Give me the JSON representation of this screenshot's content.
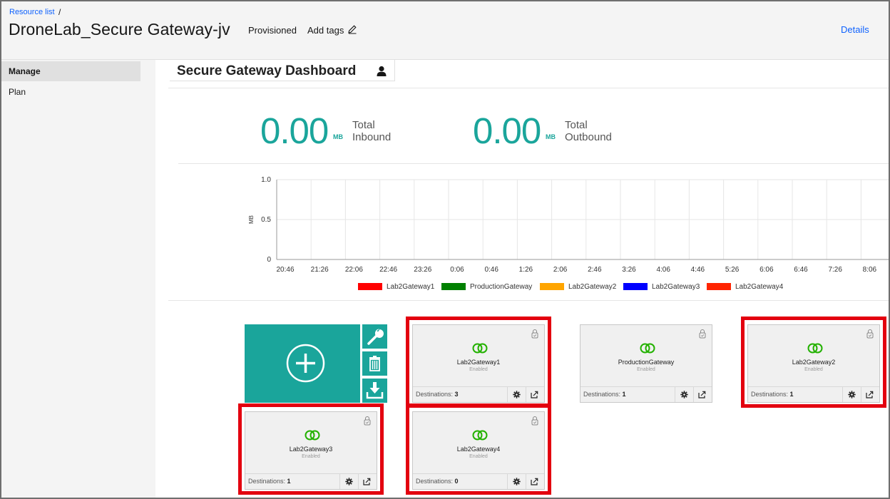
{
  "header": {
    "breadcrumb": "Resource list",
    "breadcrumb_sep": "/",
    "title": "DroneLab_Secure Gateway-jv",
    "status": "Provisioned",
    "add_tags": "Add tags",
    "details": "Details"
  },
  "sidebar": {
    "items": [
      {
        "label": "Manage",
        "active": true
      },
      {
        "label": "Plan",
        "active": false
      }
    ]
  },
  "dashboard": {
    "title": "Secure Gateway Dashboard",
    "inbound": {
      "value": "0.00",
      "unit": "MB",
      "label_line1": "Total",
      "label_line2": "Inbound"
    },
    "outbound": {
      "value": "0.00",
      "unit": "MB",
      "label_line1": "Total",
      "label_line2": "Outbound"
    }
  },
  "chart_data": {
    "type": "line",
    "ylabel": "MB",
    "ylim": [
      0,
      1.0
    ],
    "yticks": [
      "1.0",
      "0.5",
      "0"
    ],
    "categories": [
      "20:46",
      "21:26",
      "22:06",
      "22:46",
      "23:26",
      "0:06",
      "0:46",
      "1:26",
      "2:06",
      "2:46",
      "3:26",
      "4:06",
      "4:46",
      "5:26",
      "6:06",
      "6:46",
      "7:26",
      "8:06"
    ],
    "series": [
      {
        "name": "Lab2Gateway1",
        "color": "#ff0000",
        "values": [
          0,
          0,
          0,
          0,
          0,
          0,
          0,
          0,
          0,
          0,
          0,
          0,
          0,
          0,
          0,
          0,
          0,
          0
        ]
      },
      {
        "name": "ProductionGateway",
        "color": "#008000",
        "values": [
          0,
          0,
          0,
          0,
          0,
          0,
          0,
          0,
          0,
          0,
          0,
          0,
          0,
          0,
          0,
          0,
          0,
          0
        ]
      },
      {
        "name": "Lab2Gateway2",
        "color": "#ffa500",
        "values": [
          0,
          0,
          0,
          0,
          0,
          0,
          0,
          0,
          0,
          0,
          0,
          0,
          0,
          0,
          0,
          0,
          0,
          0
        ]
      },
      {
        "name": "Lab2Gateway3",
        "color": "#0000ff",
        "values": [
          0,
          0,
          0,
          0,
          0,
          0,
          0,
          0,
          0,
          0,
          0,
          0,
          0,
          0,
          0,
          0,
          0,
          0
        ]
      },
      {
        "name": "Lab2Gateway4",
        "color": "#ff2400",
        "values": [
          0,
          0,
          0,
          0,
          0,
          0,
          0,
          0,
          0,
          0,
          0,
          0,
          0,
          0,
          0,
          0,
          0,
          0
        ]
      }
    ],
    "grid": true,
    "legend": "bottom"
  },
  "gateways": [
    {
      "name": "Lab2Gateway1",
      "state": "Enabled",
      "dest_label": "Destinations:",
      "dest_count": "3",
      "highlighted": true
    },
    {
      "name": "ProductionGateway",
      "state": "Enabled",
      "dest_label": "Destinations:",
      "dest_count": "1",
      "highlighted": false
    },
    {
      "name": "Lab2Gateway2",
      "state": "Enabled",
      "dest_label": "Destinations:",
      "dest_count": "1",
      "highlighted": true
    },
    {
      "name": "Lab2Gateway3",
      "state": "Enabled",
      "dest_label": "Destinations:",
      "dest_count": "1",
      "highlighted": true
    },
    {
      "name": "Lab2Gateway4",
      "state": "Enabled",
      "dest_label": "Destinations:",
      "dest_count": "0",
      "highlighted": true
    }
  ],
  "colors": {
    "accent": "#1aa59b",
    "link": "#0f62fe",
    "highlight": "#e3000f",
    "gateway_icon": "#23b100"
  },
  "icons": {
    "add": "plus-circle-icon",
    "configure": "wrench-icon",
    "delete": "trash-icon",
    "download": "download-icon"
  }
}
